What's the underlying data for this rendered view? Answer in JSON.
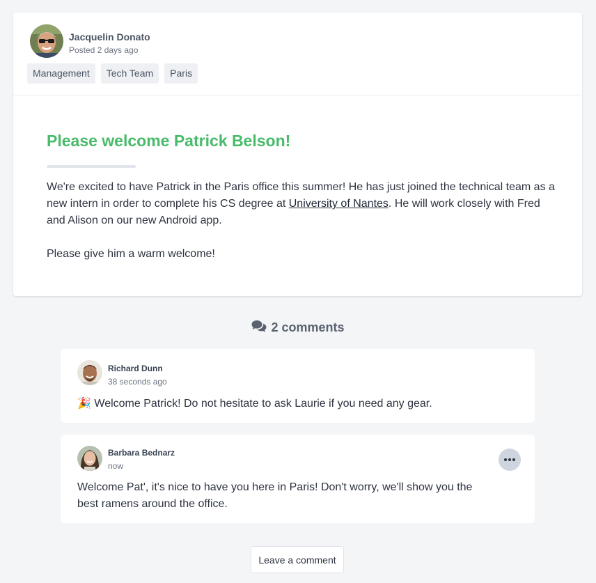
{
  "post": {
    "author": "Jacquelin Donato",
    "time": "Posted 2 days ago",
    "tags": [
      "Management",
      "Tech Team",
      "Paris"
    ],
    "title": "Please welcome Patrick Belson!",
    "body_part1": "We're excited to have Patrick in the Paris office this summer! He has just joined the technical team as a new intern in order to complete his CS degree at ",
    "body_link": "University of Nantes",
    "body_part2": ". He will work closely with Fred and Alison on our new Android app.",
    "body_para2": "Please give him a warm welcome!"
  },
  "comments_heading": {
    "label": "2 comments",
    "icon": "comments-icon"
  },
  "comments": [
    {
      "name": "Richard Dunn",
      "time": "38 seconds ago",
      "emoji": "🎉",
      "text": "Welcome Patrick! Do not hesitate to ask Laurie if you need any gear."
    },
    {
      "name": "Barbara Bednarz",
      "time": "now",
      "text": "Welcome Pat', it's nice to have you here in Paris! Don't worry, we'll show you the best ramens around the office."
    }
  ],
  "actions": {
    "leave_comment": "Leave a comment"
  },
  "colors": {
    "title": "#48bb6a",
    "background": "#f4f5f7",
    "tag_bg": "#eef0f3",
    "more_button_bg": "#cfd5de"
  }
}
